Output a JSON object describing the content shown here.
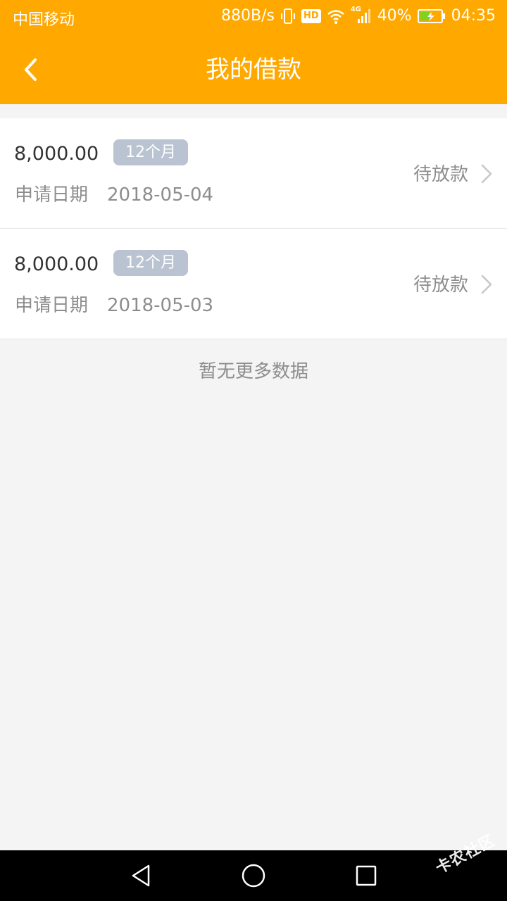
{
  "status_bar": {
    "carrier": "中国移动",
    "network_speed": "880B/s",
    "hd_badge": "HD",
    "network_type": "4G",
    "battery_percent": "40%",
    "time": "04:35"
  },
  "header": {
    "title": "我的借款",
    "back_icon": "chevron-left-icon"
  },
  "loans": [
    {
      "amount": "8,000.00",
      "term": "12个月",
      "apply_label": "申请日期",
      "apply_date": "2018-05-04",
      "status": "待放款"
    },
    {
      "amount": "8,000.00",
      "term": "12个月",
      "apply_label": "申请日期",
      "apply_date": "2018-05-03",
      "status": "待放款"
    }
  ],
  "list_footer": {
    "no_more_text": "暂无更多数据"
  },
  "watermark": {
    "text": "卡农社区"
  },
  "colors": {
    "header_background": "#ffa800",
    "page_background": "#f4f4f4",
    "badge_background": "#b9c3d1",
    "secondary_text": "#8d8d8d",
    "primary_text": "#333333"
  }
}
